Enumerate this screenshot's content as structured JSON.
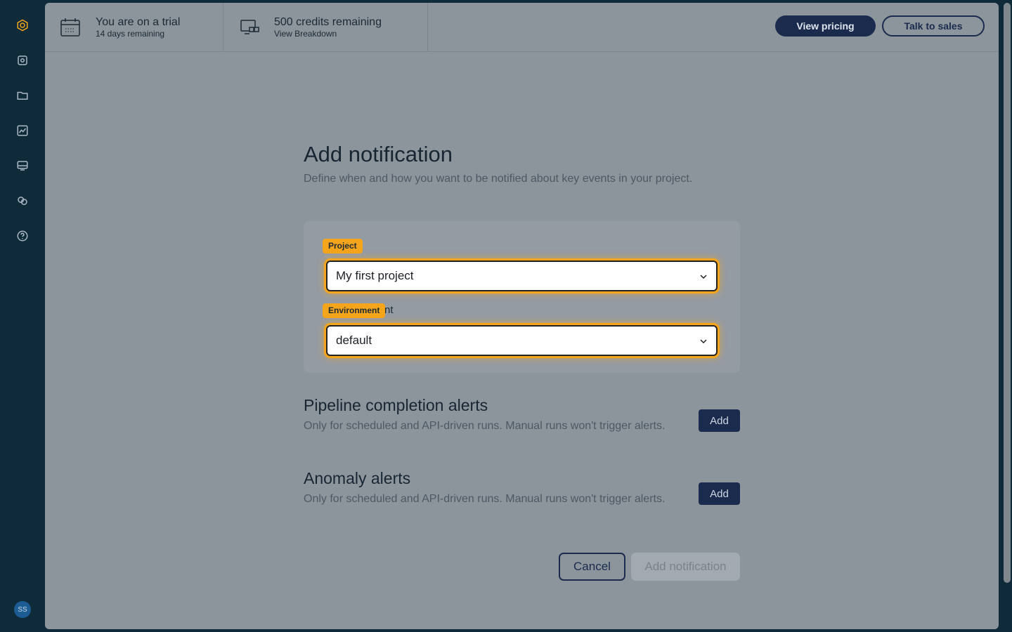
{
  "topbar": {
    "trial_title": "You are on a trial",
    "trial_sub": "14 days remaining",
    "credits_title": "500 credits remaining",
    "credits_sub": "View Breakdown",
    "pricing_label": "View pricing",
    "sales_label": "Talk to sales"
  },
  "sidebar": {
    "avatar_initials": "SS",
    "icons": [
      "logo-icon",
      "data-icon",
      "folder-icon",
      "chart-icon",
      "monitor-icon",
      "integrations-icon",
      "help-icon"
    ]
  },
  "page": {
    "title": "Add notification",
    "subtitle": "Define when and how you want to be notified about key events in your project."
  },
  "form": {
    "project_badge": "Project",
    "project_value": "My first project",
    "environment_badge": "Environment",
    "environment_label_tail": "nt",
    "environment_value": "default"
  },
  "sections": {
    "pipeline_title": "Pipeline completion alerts",
    "pipeline_sub": "Only for scheduled and API-driven runs. Manual runs won't trigger alerts.",
    "pipeline_add": "Add",
    "anomaly_title": "Anomaly alerts",
    "anomaly_sub": "Only for scheduled and API-driven runs. Manual runs won't trigger alerts.",
    "anomaly_add": "Add"
  },
  "footer": {
    "cancel_label": "Cancel",
    "submit_label": "Add notification"
  },
  "colors": {
    "accent": "#f4a51c",
    "primary": "#1a2b4d",
    "sidebar_bg": "#0f2b3a"
  }
}
